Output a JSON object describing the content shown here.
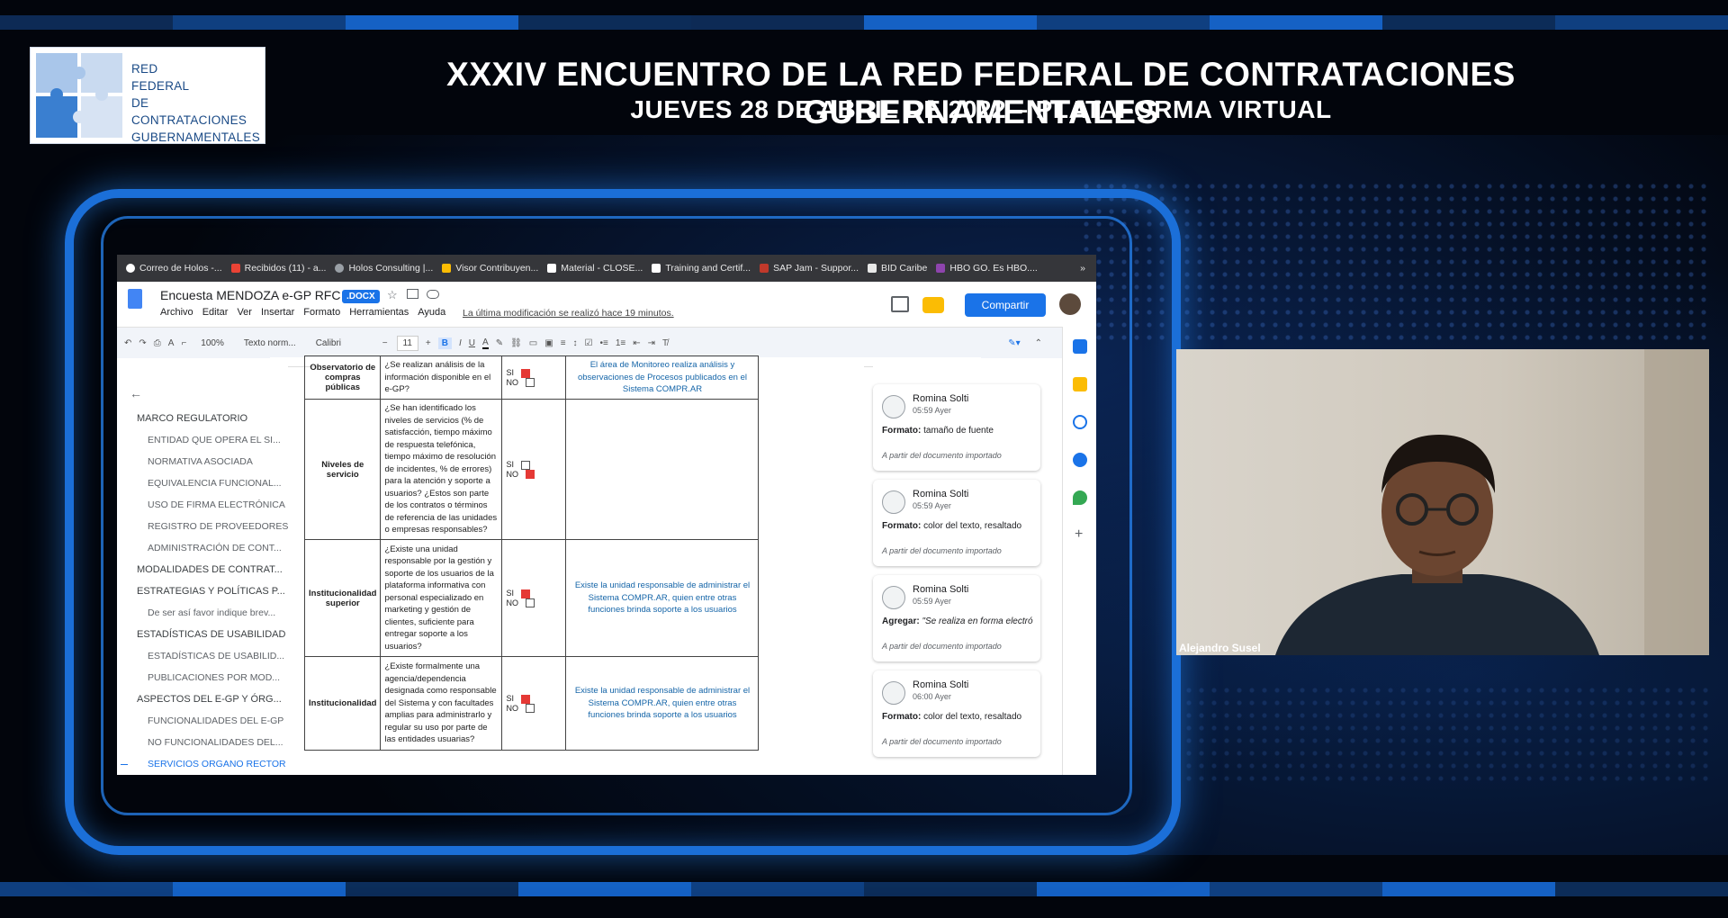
{
  "event": {
    "logo_lines": [
      "RED",
      "FEDERAL",
      "DE CONTRATACIONES",
      "GUBERNAMENTALES"
    ],
    "title": "XXXIV ENCUENTRO DE LA RED FEDERAL DE CONTRATACIONES GUBERNAMENTALES",
    "subtitle": "JUEVES 28 DE ABRIL DE 2022 – PLATAFORMA VIRTUAL"
  },
  "browser": {
    "bookmarks": [
      {
        "label": "Correo de Holos -...",
        "color": "#ffffff"
      },
      {
        "label": "Recibidos (11) - a...",
        "color": "#ea4335"
      },
      {
        "label": "Holos Consulting |...",
        "color": "#9aa0a6"
      },
      {
        "label": "Visor Contribuyen...",
        "color": "#fbbc04"
      },
      {
        "label": "Material - CLOSE...",
        "color": "#ffffff"
      },
      {
        "label": "Training and Certif...",
        "color": "#ffffff"
      },
      {
        "label": "SAP Jam - Suppor...",
        "color": "#c0392b"
      },
      {
        "label": "BID Caribe",
        "color": "#e8e8e8"
      },
      {
        "label": "HBO GO. Es HBO....",
        "color": "#8e44ad"
      }
    ],
    "bookmarks_more": "»"
  },
  "doc": {
    "title": "Encuesta MENDOZA e-GP RFC",
    "badge": ".DOCX",
    "menu": [
      "Archivo",
      "Editar",
      "Ver",
      "Insertar",
      "Formato",
      "Herramientas",
      "Ayuda"
    ],
    "last_modified": "La última modificación se realizó hace 19 minutos.",
    "share_label": "Compartir",
    "zoom": "100%",
    "style": "Texto norm...",
    "font": "Calibri",
    "font_size": "11"
  },
  "outline": {
    "items": [
      {
        "label": "MARCO REGULATORIO",
        "sub": false
      },
      {
        "label": "ENTIDAD QUE OPERA EL SI...",
        "sub": true
      },
      {
        "label": "NORMATIVA ASOCIADA",
        "sub": true
      },
      {
        "label": "EQUIVALENCIA FUNCIONAL...",
        "sub": true
      },
      {
        "label": "USO DE FIRMA ELECTRÓNICA",
        "sub": true
      },
      {
        "label": "REGISTRO DE PROVEEDORES",
        "sub": true
      },
      {
        "label": "ADMINISTRACIÓN DE CONT...",
        "sub": true
      },
      {
        "label": "MODALIDADES DE CONTRAT...",
        "sub": false
      },
      {
        "label": "ESTRATEGIAS Y POLÍTICAS P...",
        "sub": false
      },
      {
        "label": "De ser así favor indique brev...",
        "sub": true
      },
      {
        "label": "ESTADÍSTICAS DE USABILIDAD",
        "sub": false
      },
      {
        "label": "ESTADÍSTICAS DE USABILID...",
        "sub": true
      },
      {
        "label": "PUBLICACIONES POR MOD...",
        "sub": true
      },
      {
        "label": "ASPECTOS DEL E-GP Y ÓRG...",
        "sub": false
      },
      {
        "label": "FUNCIONALIDADES DEL E-GP",
        "sub": true
      },
      {
        "label": "NO FUNCIONALIDADES DEL...",
        "sub": true
      },
      {
        "label": "SERVICIOS ORGANO RECTOR",
        "sub": true,
        "active": true
      }
    ]
  },
  "table": {
    "rows": [
      {
        "label": "Observatorio de compras públicas",
        "question": "¿Se realizan análisis de la información disponible en el e-GP?",
        "si": true,
        "no": false,
        "answer": "El área de Monitoreo realiza análisis y observaciones de Procesos publicados en el Sistema COMPR.AR"
      },
      {
        "label": "Niveles de servicio",
        "question": "¿Se han identificado los niveles de servicios (% de satisfacción, tiempo máximo de respuesta telefónica, tiempo máximo de resolución de incidentes, % de errores) para la atención y soporte a usuarios? ¿Estos son parte de los contratos o términos de referencia de las unidades o empresas responsables?",
        "si": false,
        "no": true,
        "answer": ""
      },
      {
        "label": "Institucionalidad superior",
        "question": "¿Existe una unidad responsable por la gestión y soporte de los usuarios de la plataforma informativa con personal especializado en marketing y gestión de clientes, suficiente para entregar soporte a los usuarios?",
        "si": true,
        "no": false,
        "answer": "Existe la unidad responsable de administrar el Sistema COMPR.AR, quien entre otras funciones brinda soporte a los usuarios"
      },
      {
        "label": "Institucionalidad",
        "question": "¿Existe formalmente una agencia/dependencia designada como responsable del Sistema y con facultades amplias para administrarlo y regular su uso por parte de las entidades usuarias?",
        "si": true,
        "no": false,
        "answer": "Existe la unidad responsable de administrar el Sistema COMPR.AR, quien entre otras funciones brinda soporte a los usuarios"
      }
    ],
    "si_label": "SI",
    "no_label": "NO"
  },
  "comments": [
    {
      "author": "Romina Solti",
      "time": "05:59 Ayer",
      "kind": "Formato:",
      "text": " tamaño de fuente",
      "footer": "A partir del documento importado"
    },
    {
      "author": "Romina Solti",
      "time": "05:59 Ayer",
      "kind": "Formato:",
      "text": " color del texto, resaltado",
      "footer": "A partir del documento importado"
    },
    {
      "author": "Romina Solti",
      "time": "05:59 Ayer",
      "kind": "Agregar:",
      "text": " \"Se realiza en forma electró",
      "footer": "A partir del documento importado"
    },
    {
      "author": "Romina Solti",
      "time": "06:00 Ayer",
      "kind": "Formato:",
      "text": " color del texto, resaltado",
      "footer": "A partir del documento importado"
    }
  ],
  "webcam": {
    "participant": "Alejandro Susel"
  }
}
